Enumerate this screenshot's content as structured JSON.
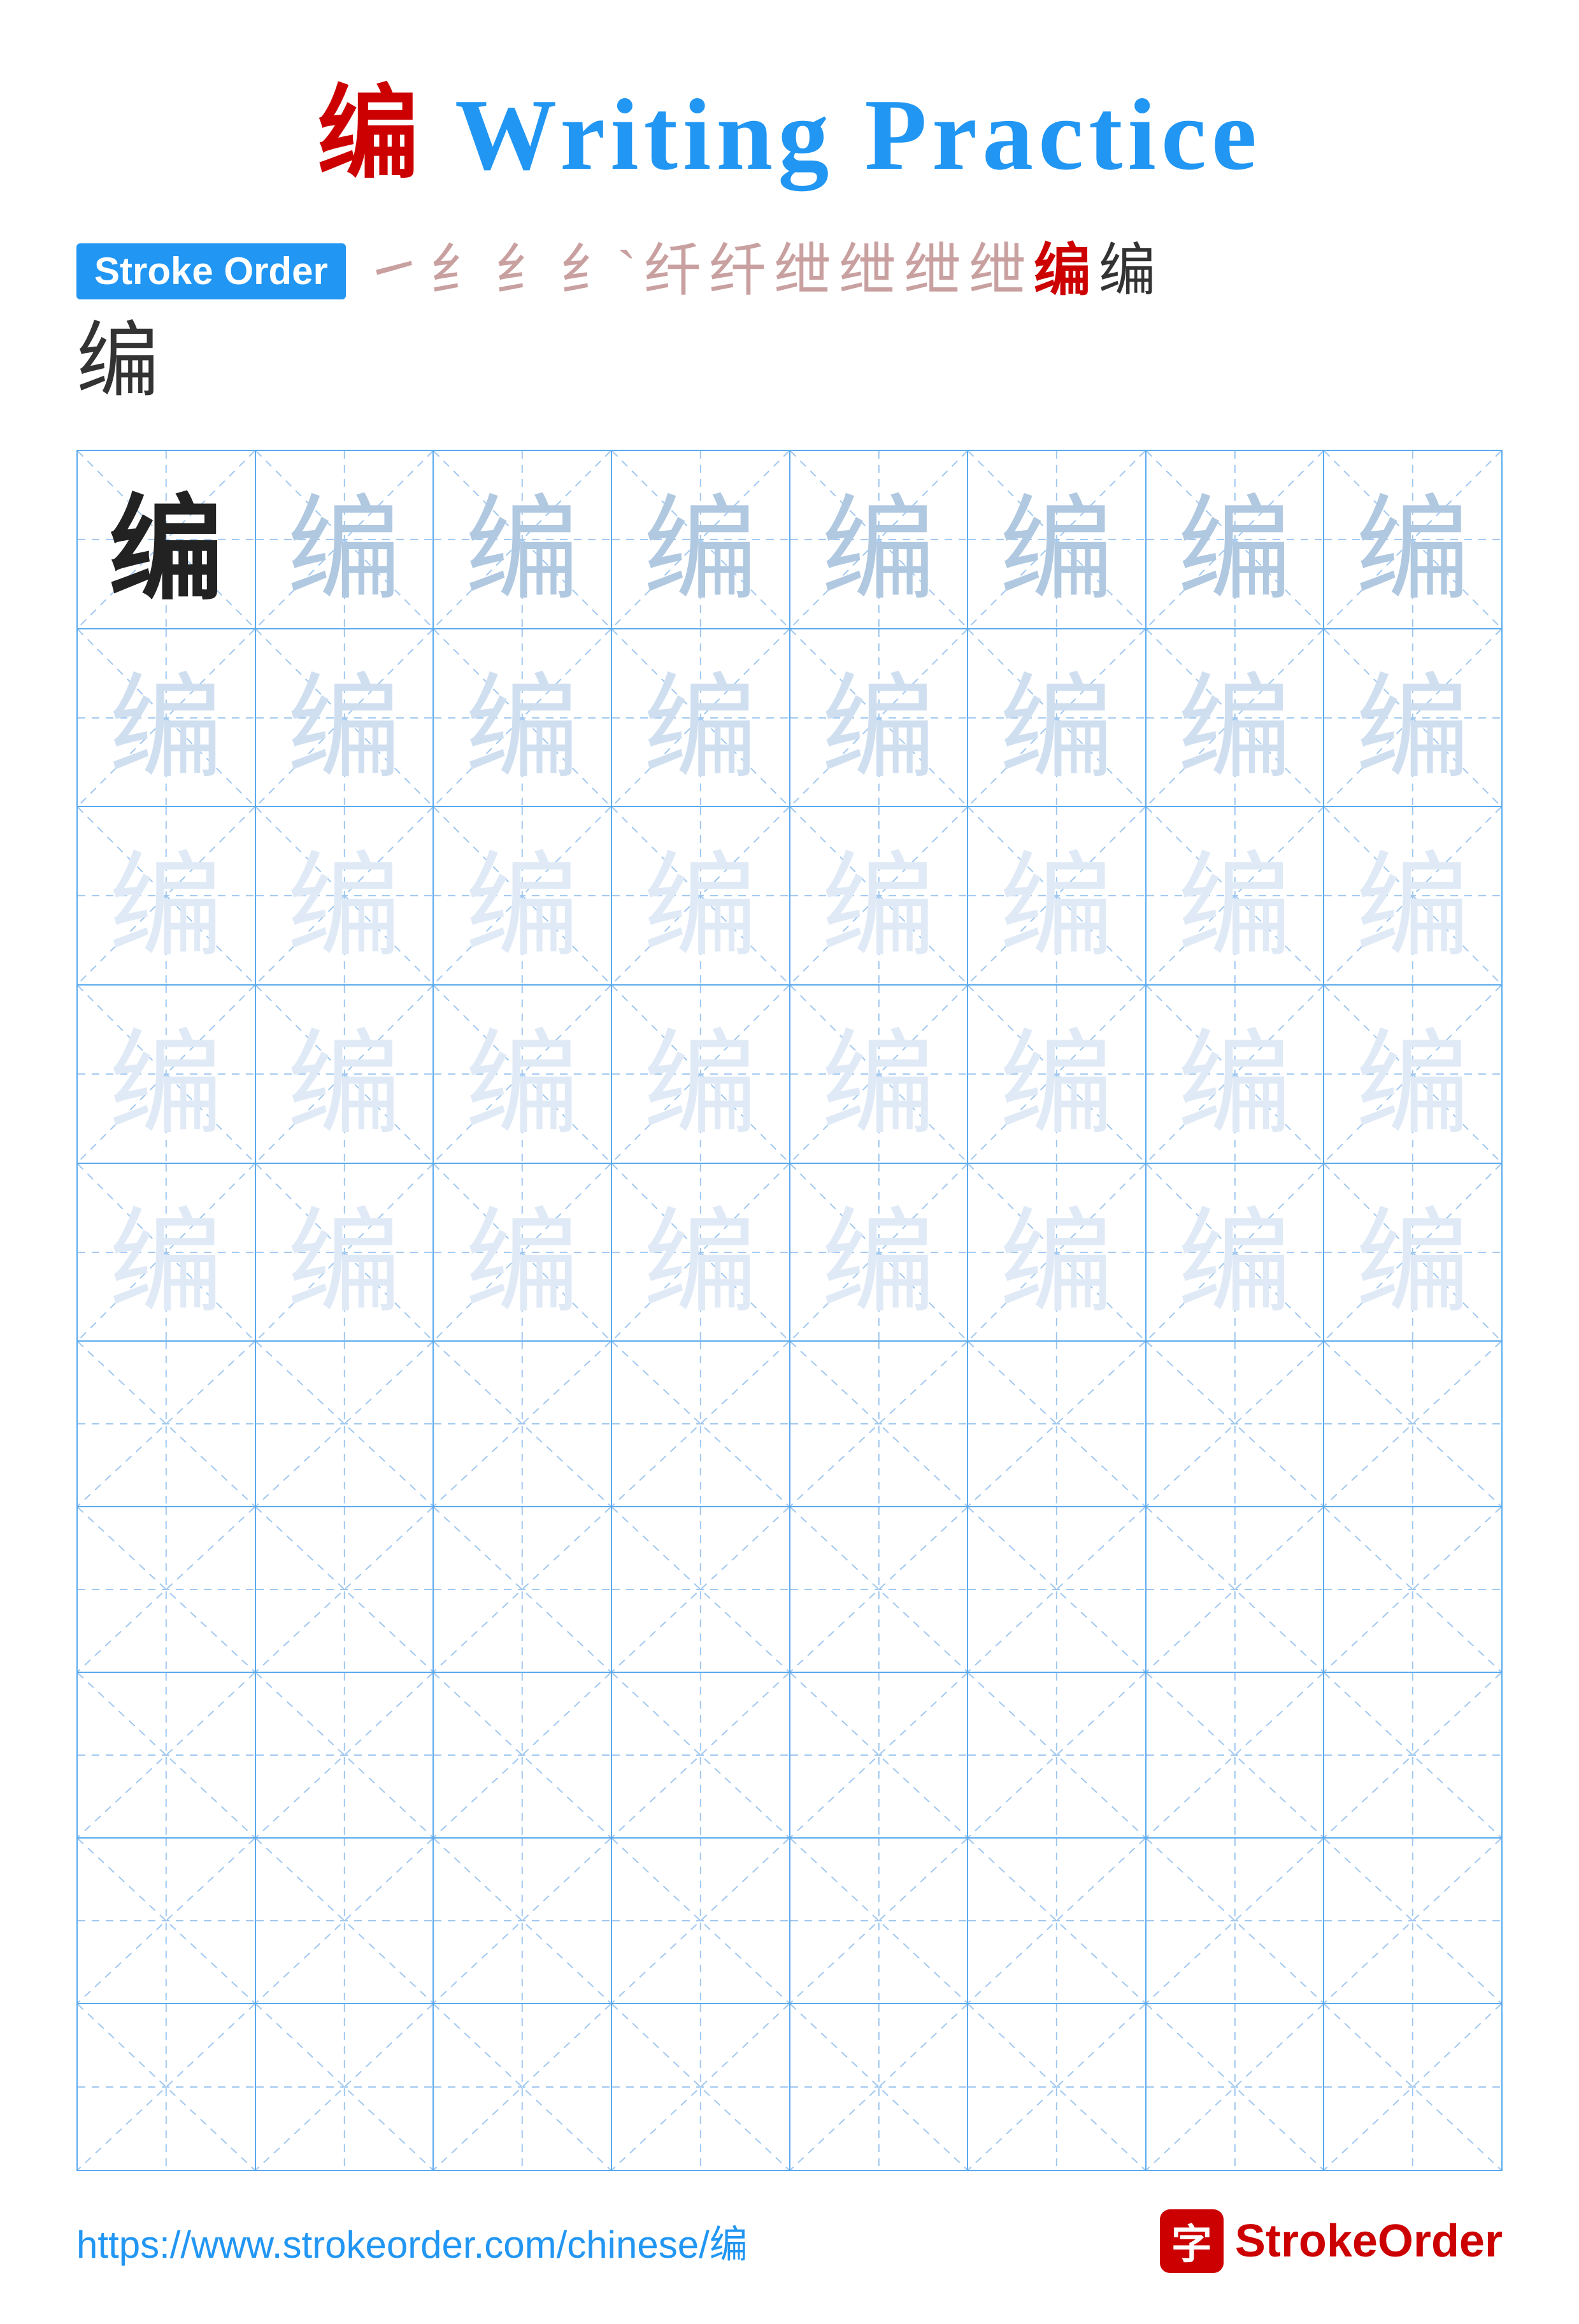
{
  "page": {
    "title_prefix": "编",
    "title_suffix": " Writing Practice",
    "stroke_order_label": "Stroke Order",
    "stroke_chars": [
      "㇀",
      "纟",
      "纟",
      "纟`",
      "纤",
      "纤",
      "绁",
      "绁",
      "绁",
      "绁",
      "编",
      "编"
    ],
    "final_char": "编",
    "character": "编",
    "grid": {
      "cols": 8,
      "practice_rows": 5,
      "char_rows": [
        [
          "dark",
          "medium",
          "medium",
          "medium",
          "medium",
          "medium",
          "medium",
          "medium"
        ],
        [
          "light",
          "light",
          "light",
          "light",
          "light",
          "light",
          "light",
          "light"
        ],
        [
          "very-light",
          "very-light",
          "very-light",
          "very-light",
          "very-light",
          "very-light",
          "very-light",
          "very-light"
        ],
        [
          "very-light",
          "very-light",
          "very-light",
          "very-light",
          "very-light",
          "very-light",
          "very-light",
          "very-light"
        ],
        [
          "very-light",
          "very-light",
          "very-light",
          "very-light",
          "very-light",
          "very-light",
          "very-light",
          "very-light"
        ]
      ]
    },
    "footer": {
      "url": "https://www.strokeorder.com/chinese/编",
      "brand": "StrokeOrder",
      "brand_accent": "Stroke",
      "logo_char": "字"
    }
  }
}
